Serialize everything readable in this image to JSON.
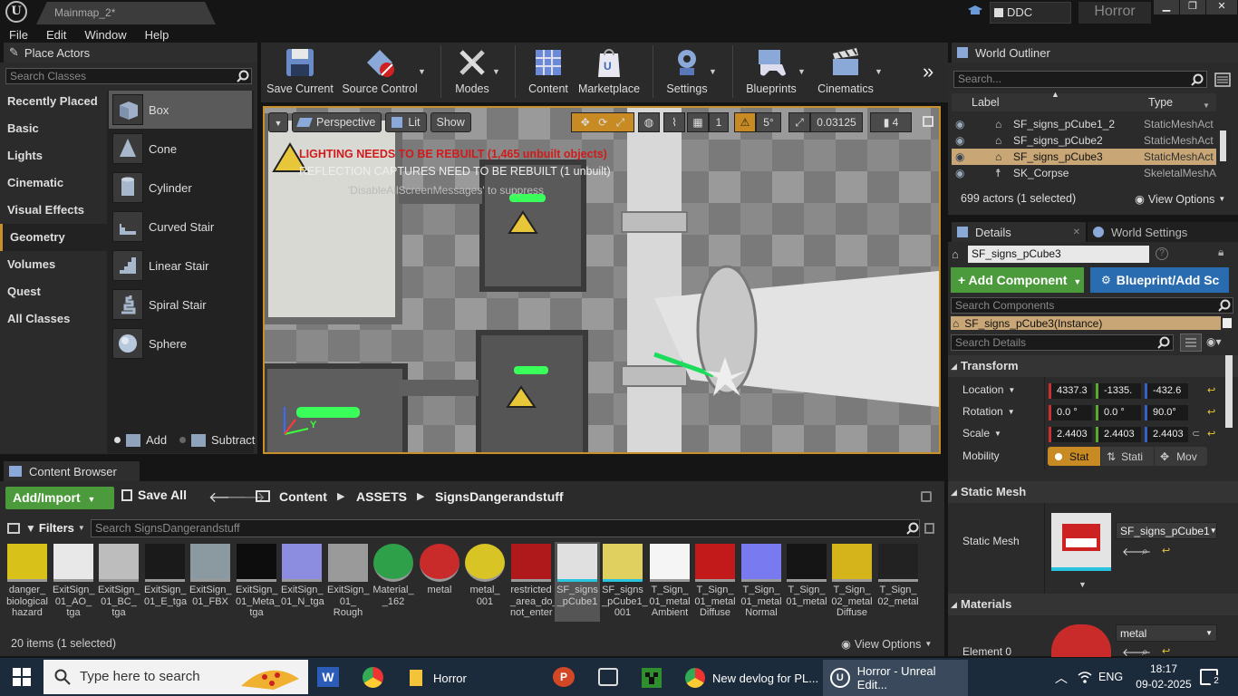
{
  "titlebar": {
    "logo": "U",
    "map_tab": "Mainmap_2*",
    "source_control_label": "DDC",
    "project": "Horror",
    "min": "▁",
    "max": "❐",
    "close": "✕"
  },
  "menubar": {
    "items": [
      "File",
      "Edit",
      "Window",
      "Help"
    ]
  },
  "place_actors": {
    "tab_label": "Place Actors",
    "search_placeholder": "Search Classes",
    "categories": [
      "Recently Placed",
      "Basic",
      "Lights",
      "Cinematic",
      "Visual Effects",
      "Geometry",
      "Volumes",
      "Quest",
      "All Classes"
    ],
    "selected_category": "Geometry",
    "items": [
      "Box",
      "Cone",
      "Cylinder",
      "Curved Stair",
      "Linear Stair",
      "Spiral Stair",
      "Sphere"
    ],
    "add_label": "Add",
    "subtract_label": "Subtract"
  },
  "toolbar": {
    "save_current": "Save Current",
    "source_control": "Source Control",
    "modes": "Modes",
    "content": "Content",
    "marketplace": "Marketplace",
    "settings": "Settings",
    "blueprints": "Blueprints",
    "cinematics": "Cinematics",
    "more": "»"
  },
  "viewport": {
    "perspective": "Perspective",
    "lit": "Lit",
    "show": "Show",
    "grid_value": "1",
    "rotation_snap": "5°",
    "scale_snap": "0.03125",
    "camera_speed": "4",
    "warning_lighting": "LIGHTING NEEDS TO BE REBUILT (1,465 unbuilt objects)",
    "warning_reflection": "REFLECTION CAPTURES NEED TO BE REBUILT (1 unbuilt)",
    "disable_msg": "'DisableAllScreenMessages' to suppress",
    "axis_y": "Y"
  },
  "content_browser": {
    "tab_label": "Content Browser",
    "add_import": "Add/Import",
    "save_all": "Save All",
    "breadcrumbs": [
      "Content",
      "ASSETS",
      "SignsDangerandstuff"
    ],
    "filters": "Filters",
    "search_placeholder": "Search SignsDangerandstuff",
    "assets": [
      {
        "label": "danger_\nbiological\nhazard",
        "thumb": "#d8c21a"
      },
      {
        "label": "ExitSign_\n01_AO_\ntga",
        "thumb": "#e8e8e8"
      },
      {
        "label": "ExitSign_\n01_BC_\ntga",
        "thumb": "#bdbdbd"
      },
      {
        "label": "ExitSign_\n01_E_tga",
        "thumb": "#1a1a1a"
      },
      {
        "label": "ExitSign_\n01_FBX",
        "thumb": "#8a9aa0"
      },
      {
        "label": "ExitSign_\n01_Meta_\ntga",
        "thumb": "#0d0d0d"
      },
      {
        "label": "ExitSign_\n01_N_tga",
        "thumb": "#8c8ce0"
      },
      {
        "label": "ExitSign_\n01_\nRough",
        "thumb": "#9a9a9a"
      },
      {
        "label": "Material_\n_162",
        "thumb": "#2fa04a"
      },
      {
        "label": "metal",
        "thumb": "#c92b2b"
      },
      {
        "label": "metal_\n001",
        "thumb": "#d8c525"
      },
      {
        "label": "restricted\n_area_do_\nnot_enter",
        "thumb": "#b0191c"
      },
      {
        "label": "SF_signs\n_pCube1",
        "thumb": "#e0e0e0"
      },
      {
        "label": "SF_signs\n_pCube1_\n001",
        "thumb": "#e0d060"
      },
      {
        "label": "T_Sign_\n01_metal\nAmbient",
        "thumb": "#f5f5f5"
      },
      {
        "label": "T_Sign_\n01_metal\nDiffuse",
        "thumb": "#c21a1a"
      },
      {
        "label": "T_Sign_\n01_metal\nNormal",
        "thumb": "#7a7af0"
      },
      {
        "label": "T_Sign_\n01_metal",
        "thumb": "#151515"
      },
      {
        "label": "T_Sign_\n02_metal\nDiffuse",
        "thumb": "#d4b41a"
      },
      {
        "label": "T_Sign_\n02_metal",
        "thumb": "#222"
      }
    ],
    "selected_asset": "SF_signs\n_pCube1",
    "status": "20 items (1 selected)",
    "view_options": "View Options"
  },
  "world_outliner": {
    "tab_label": "World Outliner",
    "search_placeholder": "Search...",
    "col_label": "Label",
    "col_type": "Type",
    "rows": [
      {
        "label": "SF_signs_pCube1_2",
        "type": "StaticMeshAct"
      },
      {
        "label": "SF_signs_pCube2",
        "type": "StaticMeshAct"
      },
      {
        "label": "SF_signs_pCube3",
        "type": "StaticMeshAct"
      },
      {
        "label": "SK_Corpse",
        "type": "SkeletalMeshA"
      }
    ],
    "selected_row": "SF_signs_pCube3",
    "status": "699 actors (1 selected)",
    "view_options": "View Options"
  },
  "details": {
    "tab_details": "Details",
    "tab_world_settings": "World Settings",
    "name_value": "SF_signs_pCube3",
    "add_component": "+ Add Component",
    "blueprint_btn": "Blueprint/Add Sc",
    "search_components": "Search Components",
    "instance_label": "SF_signs_pCube3(Instance)",
    "search_details": "Search Details",
    "transform_header": "Transform",
    "location_label": "Location",
    "location": [
      "4337.3",
      "-1335.",
      "-432.6"
    ],
    "rotation_label": "Rotation",
    "rotation": [
      "0.0 °",
      "0.0 °",
      "90.0°"
    ],
    "scale_label": "Scale",
    "scale": [
      "2.4403",
      "2.4403",
      "2.4403"
    ],
    "mobility_label": "Mobility",
    "mobility_options": [
      "Stat",
      "Stati",
      "Mov"
    ],
    "static_mesh_header": "Static Mesh",
    "static_mesh_label": "Static Mesh",
    "static_mesh_value": "SF_signs_pCube1",
    "materials_header": "Materials",
    "element0_label": "Element 0",
    "element0_value": "metal"
  },
  "taskbar": {
    "search_placeholder": "Type here to search",
    "items": [
      "Horror",
      "New devlog for PL...",
      "Horror - Unreal Edit..."
    ],
    "language": "ENG",
    "time": "18:17",
    "date": "09-02-2025",
    "notifications": "2"
  },
  "colors": {
    "accent_orange": "#c8902a",
    "add_green": "#4b9b3c",
    "blueprint_blue": "#2a6cb0",
    "selected_row": "#c8a676",
    "warning_red": "#d21a1a"
  }
}
